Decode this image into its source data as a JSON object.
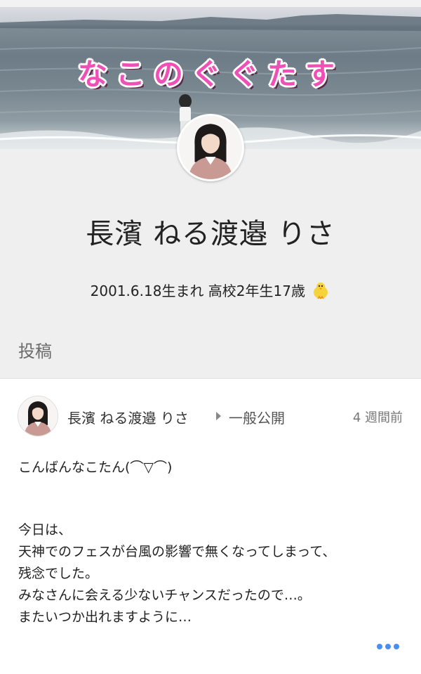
{
  "cover": {
    "title": "なこのぐぐたす"
  },
  "profile": {
    "name": "長濱 ねる渡邉 りさ",
    "bio": "2001.6.18生まれ 高校2年生17歳",
    "bio_icon": "chick-icon"
  },
  "posts_section": {
    "label": "投稿"
  },
  "post": {
    "author": "長濱 ねる渡邉 りさ",
    "visibility": "一般公開",
    "time": "4 週間前",
    "lines": [
      "こんばんなこたん(⌒▽⌒)",
      " 今日は、",
      "天神でのフェスが台風の影響で無くなってしまって、",
      "残念でした。",
      "みなさんに会える少ないチャンスだったので…。",
      "またいつか出れますように…"
    ],
    "more_icon": "more-dots-icon"
  },
  "colors": {
    "cover_title": "#f04fb6",
    "profile_bg": "#efefef",
    "more_dots": "#4a8ef2"
  }
}
